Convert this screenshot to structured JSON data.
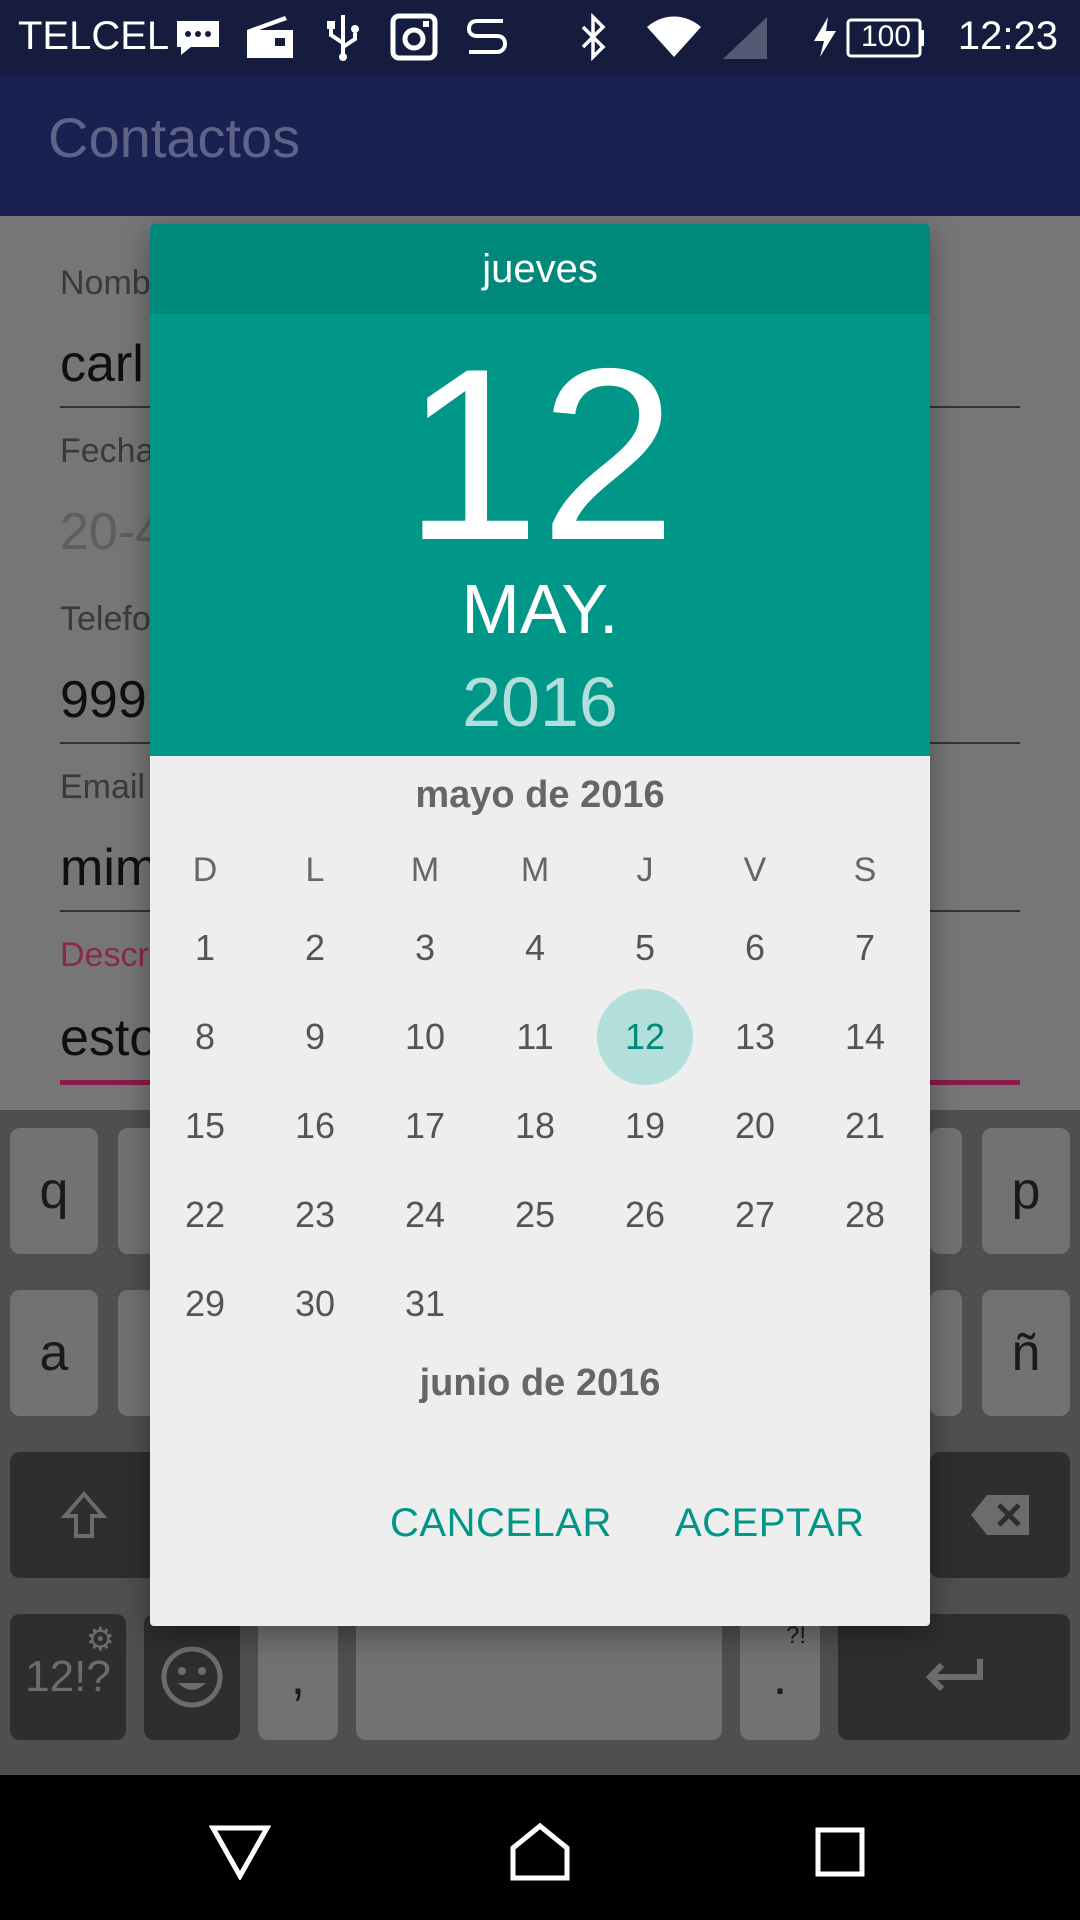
{
  "status_bar": {
    "carrier": "TELCEL",
    "battery": "100",
    "time": "12:23"
  },
  "app_bar": {
    "title": "Contactos"
  },
  "form": {
    "fields": [
      {
        "label": "Nomb",
        "value": "carl"
      },
      {
        "label": "Fecha",
        "value": "20-4"
      },
      {
        "label": "Telefo",
        "value": "999"
      },
      {
        "label": "Email",
        "value": "mim"
      },
      {
        "label": "Descr",
        "value": "esto"
      }
    ]
  },
  "keyboard": {
    "row1_left": "q",
    "row1_right": "p",
    "row2_left": "a",
    "row2_right": "ñ",
    "symbols": "12!?",
    "comma": ",",
    "period": ".",
    "period_hint": "?!"
  },
  "date_picker": {
    "weekday": "jueves",
    "day": "12",
    "month": "MAY.",
    "year": "2016",
    "month_title": "mayo de 2016",
    "next_month_title": "junio de 2016",
    "days_of_week": [
      "D",
      "L",
      "M",
      "M",
      "J",
      "V",
      "S"
    ],
    "selected_day": "12",
    "weeks": [
      [
        "1",
        "2",
        "3",
        "4",
        "5",
        "6",
        "7"
      ],
      [
        "8",
        "9",
        "10",
        "11",
        "12",
        "13",
        "14"
      ],
      [
        "15",
        "16",
        "17",
        "18",
        "19",
        "20",
        "21"
      ],
      [
        "22",
        "23",
        "24",
        "25",
        "26",
        "27",
        "28"
      ],
      [
        "29",
        "30",
        "31",
        "",
        "",
        "",
        ""
      ]
    ],
    "cancel_label": "CANCELAR",
    "accept_label": "ACEPTAR"
  },
  "colors": {
    "accent": "#009688",
    "accent_dark": "#00897b",
    "selected_bg": "#b2dfdb",
    "app_bar": "#1a2150"
  }
}
